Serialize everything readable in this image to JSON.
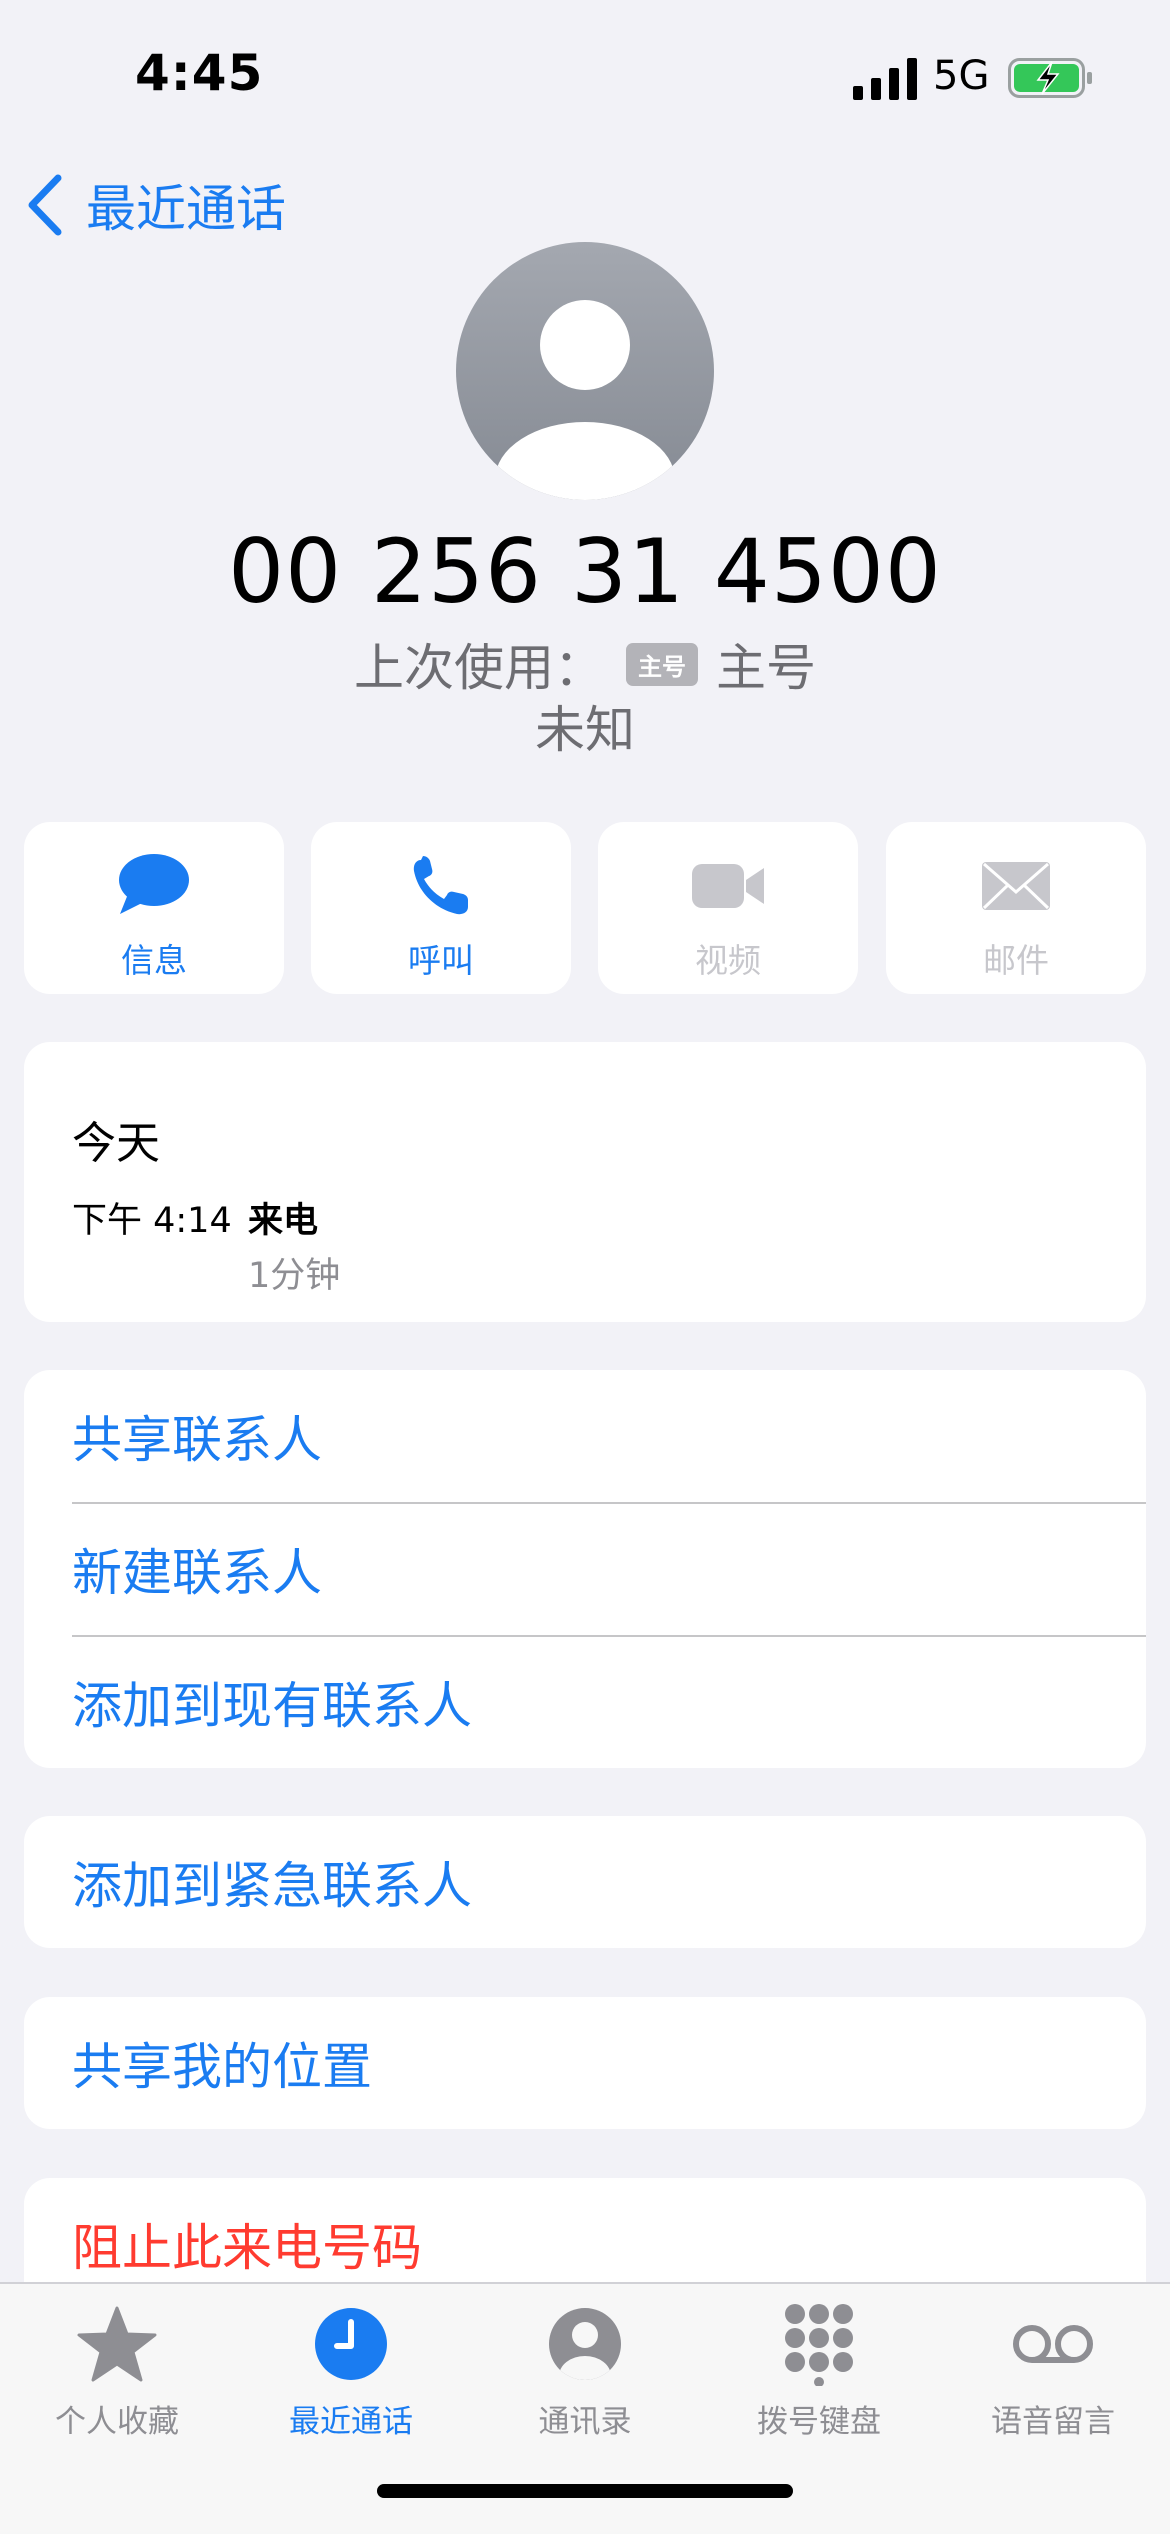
{
  "status_bar": {
    "time": "4:45",
    "network": "5G",
    "signal_icon": "cellular-signal-icon",
    "battery_icon": "battery-charging-icon"
  },
  "nav": {
    "back_label": "最近通话"
  },
  "contact": {
    "phone_number": "00 256 31 4500",
    "last_used_label": "上次使用：",
    "sim_badge": "主号",
    "sim_name": "主号",
    "location": "未知"
  },
  "actions": [
    {
      "label": "信息",
      "icon": "message-icon",
      "enabled": true
    },
    {
      "label": "呼叫",
      "icon": "phone-icon",
      "enabled": true
    },
    {
      "label": "视频",
      "icon": "video-icon",
      "enabled": false
    },
    {
      "label": "邮件",
      "icon": "mail-icon",
      "enabled": false
    }
  ],
  "history": {
    "date": "今天",
    "time": "下午 4:14",
    "type": "来电",
    "duration": "1分钟"
  },
  "options_group1": [
    {
      "label": "共享联系人"
    },
    {
      "label": "新建联系人"
    },
    {
      "label": "添加到现有联系人"
    }
  ],
  "emergency": {
    "label": "添加到紧急联系人"
  },
  "location_share": {
    "label": "共享我的位置"
  },
  "block": {
    "label": "阻止此来电号码"
  },
  "tabs": [
    {
      "label": "个人收藏",
      "icon": "star-icon",
      "active": false
    },
    {
      "label": "最近通话",
      "icon": "clock-icon",
      "active": true
    },
    {
      "label": "通讯录",
      "icon": "person-circle-icon",
      "active": false
    },
    {
      "label": "拨号键盘",
      "icon": "keypad-icon",
      "active": false
    },
    {
      "label": "语音留言",
      "icon": "voicemail-icon",
      "active": false
    }
  ],
  "colors": {
    "accent": "#1a7cf1",
    "destructive": "#ff3b30",
    "background": "#f2f2f7",
    "disabled": "#c7c7cc"
  }
}
